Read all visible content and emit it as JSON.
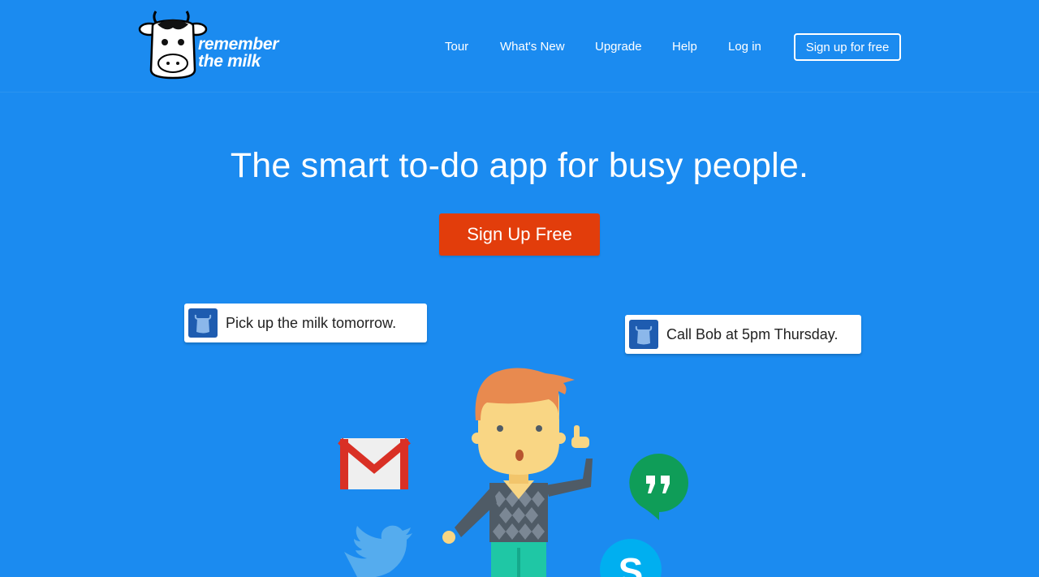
{
  "brand": {
    "line1": "remember",
    "line2": "the milk"
  },
  "nav": {
    "items": [
      {
        "label": "Tour"
      },
      {
        "label": "What's New"
      },
      {
        "label": "Upgrade"
      },
      {
        "label": "Help"
      },
      {
        "label": "Log in"
      }
    ],
    "signup_label": "Sign up for free"
  },
  "hero": {
    "title": "The smart to-do app for busy people.",
    "cta_label": "Sign Up Free"
  },
  "notifications": [
    {
      "text": "Pick up the milk tomorrow."
    },
    {
      "text": "Call Bob at 5pm Thursday."
    }
  ],
  "integrations": [
    "gmail-icon",
    "google-hangouts-icon",
    "twitter-icon",
    "skype-icon"
  ],
  "colors": {
    "background": "#1b8bf0",
    "cta": "#e23d0b",
    "app_icon": "#1e5cb0"
  }
}
